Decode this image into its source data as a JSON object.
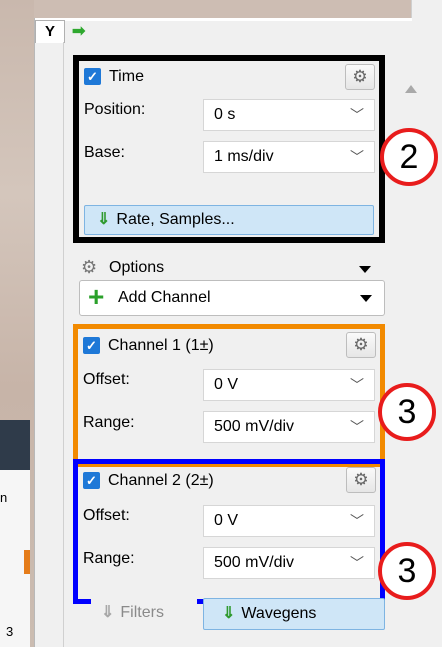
{
  "tab": {
    "label": "Y"
  },
  "time_group": {
    "title": "Time",
    "position_label": "Position:",
    "position_value": "0 s",
    "base_label": "Base:",
    "base_value": "1 ms/div",
    "rate_button": "Rate, Samples..."
  },
  "options": {
    "label": "Options"
  },
  "add_channel": {
    "label": "Add Channel"
  },
  "channel1": {
    "title": "Channel 1 (1±)",
    "offset_label": "Offset:",
    "offset_value": "0 V",
    "range_label": "Range:",
    "range_value": "500 mV/div"
  },
  "channel2": {
    "title": "Channel 2 (2±)",
    "offset_label": "Offset:",
    "offset_value": "0 V",
    "range_label": "Range:",
    "range_value": "500 mV/div"
  },
  "bottom_tabs": {
    "filters": "Filters",
    "wavegens": "Wavegens"
  },
  "annotations": {
    "time_marker": "2",
    "ch1_marker": "3",
    "ch2_marker": "3"
  },
  "background_fragments": {
    "text_a": "n",
    "text_b": "3"
  },
  "colors": {
    "time_border": "#000000",
    "ch1_border": "#f28a00",
    "ch2_border": "#0000ff",
    "annotation": "#e81c1c",
    "accent_button": "#cfe6f7"
  }
}
